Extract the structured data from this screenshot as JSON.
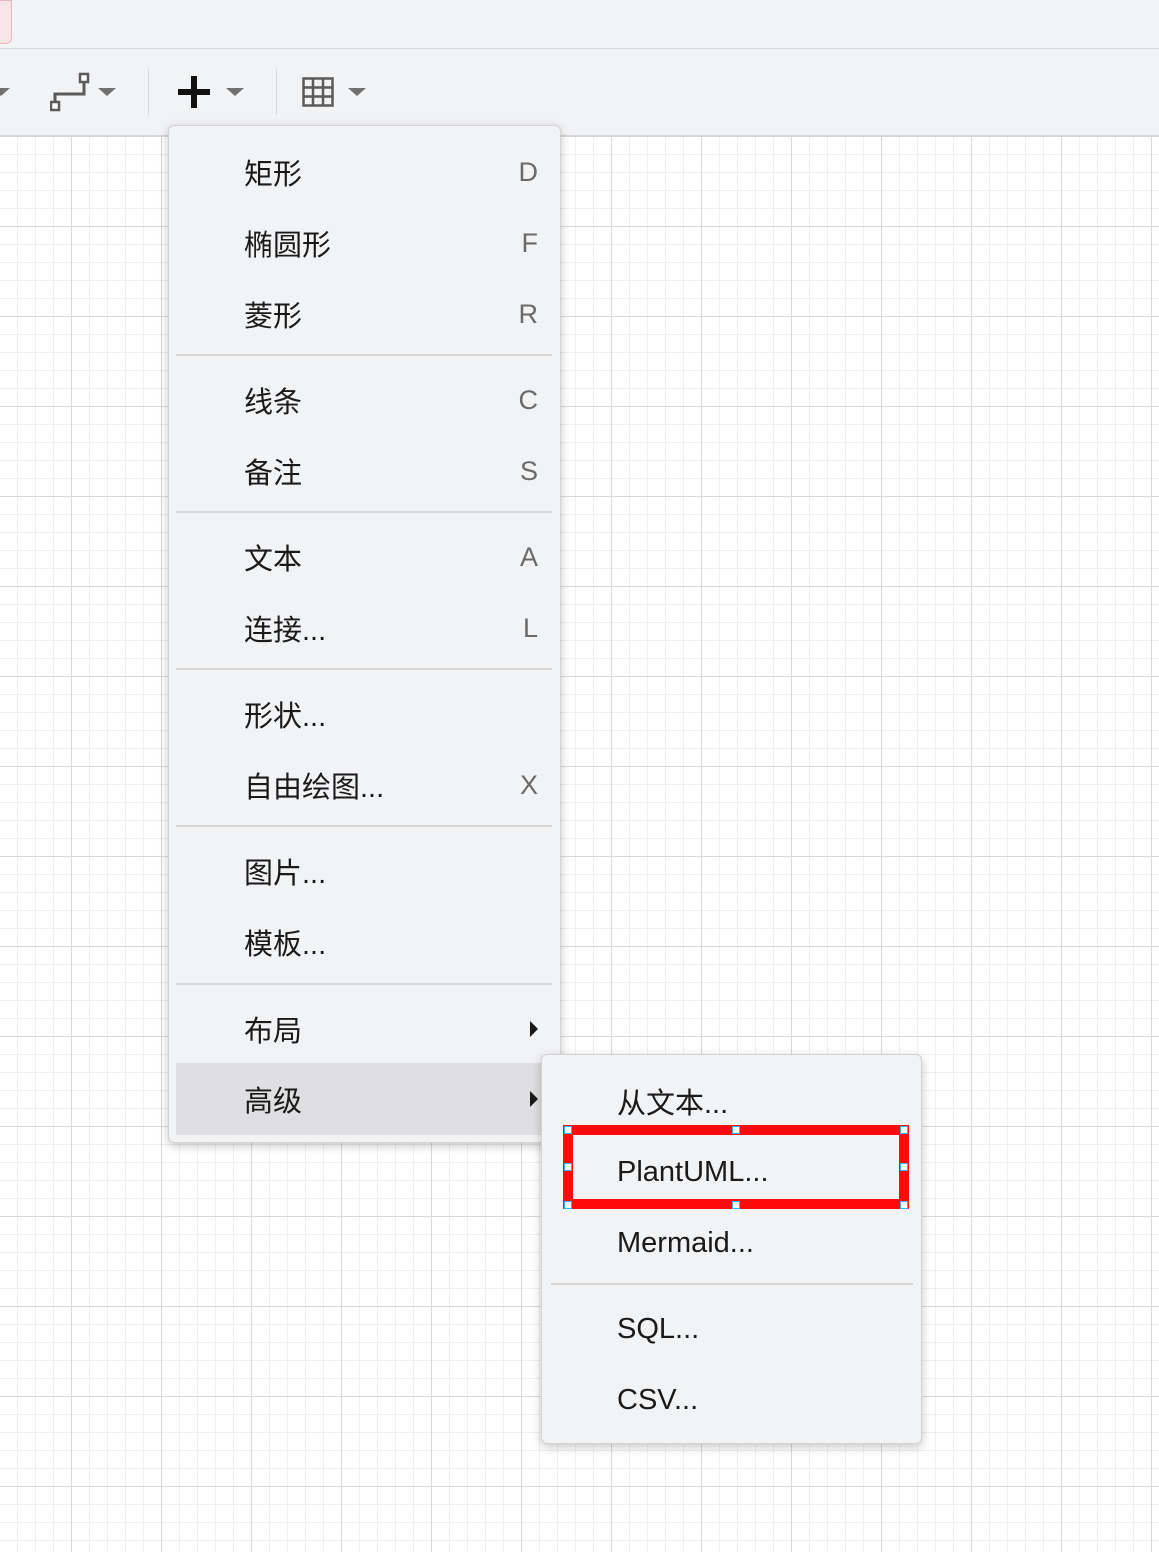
{
  "toolbar": {
    "icons": [
      "caret-icon",
      "waypoint-icon",
      "plus-icon",
      "table-icon"
    ]
  },
  "insert_menu": {
    "items": [
      {
        "label": "矩形",
        "shortcut": "D"
      },
      {
        "label": "椭圆形",
        "shortcut": "F"
      },
      {
        "label": "菱形",
        "shortcut": "R"
      },
      {
        "label": "线条",
        "shortcut": "C"
      },
      {
        "label": "备注",
        "shortcut": "S"
      },
      {
        "label": "文本",
        "shortcut": "A"
      },
      {
        "label": "连接...",
        "shortcut": "L"
      },
      {
        "label": "形状...",
        "shortcut": ""
      },
      {
        "label": "自由绘图...",
        "shortcut": "X"
      },
      {
        "label": "图片...",
        "shortcut": ""
      },
      {
        "label": "模板...",
        "shortcut": ""
      },
      {
        "label": "布局",
        "submenu": true
      },
      {
        "label": "高级",
        "submenu": true,
        "active": true
      }
    ]
  },
  "advanced_submenu": {
    "items": [
      {
        "label": "从文本..."
      },
      {
        "label": "PlantUML...",
        "highlighted": true
      },
      {
        "label": "Mermaid..."
      },
      {
        "label": "SQL..."
      },
      {
        "label": "CSV..."
      }
    ]
  },
  "colors": {
    "highlight": "#ff0a0a",
    "handle": "#29b6f2",
    "menu_bg": "#f2f3f5",
    "active_bg": "#dfdfe1"
  }
}
